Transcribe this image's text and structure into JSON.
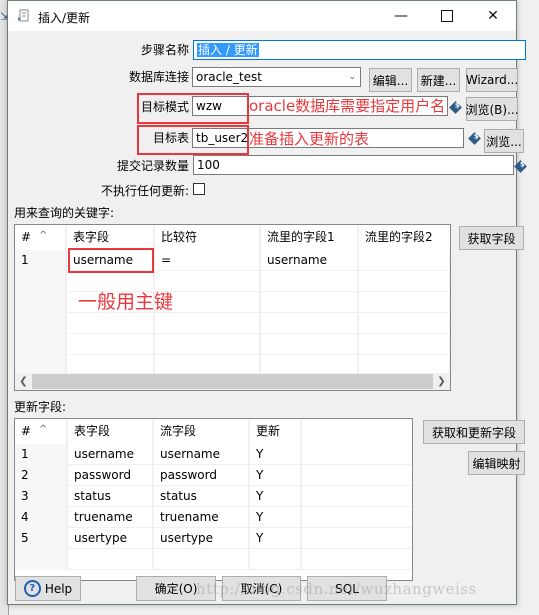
{
  "window": {
    "title": "插入/更新",
    "minimize_icon": "minimize-icon",
    "maximize_icon": "maximize-icon",
    "close_icon": "close-icon"
  },
  "form": {
    "step_name_label": "步骤名称",
    "step_name_value": "插入 / 更新",
    "connection_label": "数据库连接",
    "connection_value": "oracle_test",
    "edit_button": "编辑...",
    "new_button": "新建...",
    "wizard_button": "Wizard...",
    "schema_label": "目标模式",
    "schema_value": "wzw",
    "browse_schema_button": "浏览(B)...",
    "table_label": "目标表",
    "table_value": "tb_user2",
    "browse_table_button": "浏览...",
    "commit_label": "提交记录数量",
    "commit_value": "100",
    "no_update_label": "不执行任何更新:",
    "no_update_checked": false
  },
  "annotations": {
    "schema_note": "oracle数据库需要指定用户名",
    "table_note": "准备插入更新的表",
    "key_note": "一般用主键"
  },
  "keys": {
    "section_label": "用来查询的关键字:",
    "get_fields_button": "获取字段",
    "columns": [
      "#",
      "表字段",
      "比较符",
      "流里的字段1",
      "流里的字段2"
    ],
    "rows": [
      [
        "1",
        "username",
        "=",
        "username",
        ""
      ]
    ]
  },
  "updates": {
    "section_label": "更新字段:",
    "get_update_fields_button": "获取和更新字段",
    "edit_mapping_button": "编辑映射",
    "columns": [
      "#",
      "表字段",
      "流字段",
      "更新"
    ],
    "rows": [
      [
        "1",
        "username",
        "username",
        "Y"
      ],
      [
        "2",
        "password",
        "password",
        "Y"
      ],
      [
        "3",
        "status",
        "status",
        "Y"
      ],
      [
        "4",
        "truename",
        "truename",
        "Y"
      ],
      [
        "5",
        "usertype",
        "usertype",
        "Y"
      ]
    ]
  },
  "footer": {
    "help_button": "Help",
    "ok_button": "确定(O)",
    "cancel_button": "取消(C)",
    "sql_button": "SQL"
  },
  "watermark": "http://blog.csdn.net/wuzhangweiss",
  "colors": {
    "annotation_red": "#e8383d",
    "selection_blue": "#3399ff",
    "variable_icon": "#2e5b88"
  }
}
